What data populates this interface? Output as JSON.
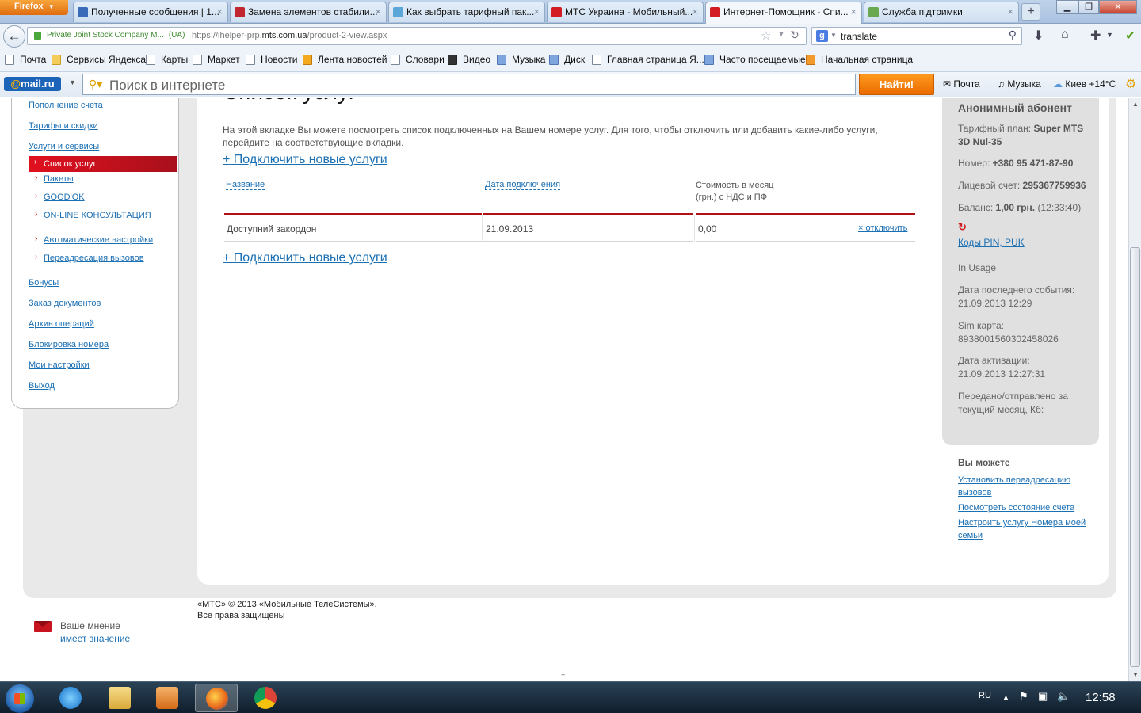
{
  "browser": {
    "app_button": "Firefox",
    "tabs": [
      {
        "title": "Полученные сообщения | 1...",
        "active": false
      },
      {
        "title": "Замена элементов стабили...",
        "active": false
      },
      {
        "title": "Как выбрать тарифный пак...",
        "active": false
      },
      {
        "title": "МТС Украина - Мобильный...",
        "active": false
      },
      {
        "title": "Интернет-Помощник - Спи...",
        "active": true
      },
      {
        "title": "Служба підтримки",
        "active": false
      }
    ],
    "identity": "Private Joint Stock Company M...",
    "identity_country": "(UA)",
    "url_prefix": "https://ihelper-prp.",
    "url_domain": "mts.com.ua",
    "url_path": "/product-2-view.aspx",
    "search_query": "translate",
    "bookmarks": [
      "Почта",
      "Сервисы Яндекса",
      "Карты",
      "Маркет",
      "Новости",
      "Лента новостей",
      "Словари",
      "Видео",
      "Музыка",
      "Диск",
      "Главная страница Я...",
      "Часто посещаемые",
      "Начальная страница"
    ]
  },
  "mailru_bar": {
    "logo_at": "@",
    "logo_text": "mail.ru",
    "search_placeholder": "Поиск в интернете",
    "find_button": "Найти!",
    "mail_label": "Почта",
    "music_label": "Музыка",
    "weather": "Киев +14°C"
  },
  "sidebar": {
    "links": [
      "Пополнение счета",
      "Тарифы и скидки",
      "Услуги и сервисы"
    ],
    "active_sub": "Список услуг",
    "subs": [
      "Пакеты",
      "GOOD'OK",
      "ON-LINE КОНСУЛЬТАЦИЯ",
      "Автоматические настройки",
      "Переадресация вызовов"
    ],
    "links_bottom": [
      "Бонусы",
      "Заказ документов",
      "Архив операций",
      "Блокировка номера",
      "Мои настройки",
      "Выход"
    ]
  },
  "main": {
    "title": "Список услуг",
    "intro": "На этой вкладке Вы можете посмотреть список подключенных на Вашем номере услуг. Для того, чтобы отключить или добавить какие-либо услуги, перейдите на соответствующие вкладки.",
    "add_link": "+ Подключить новые услуги",
    "columns": {
      "name": "Название",
      "date": "Дата подключения",
      "cost_line1": "Стоимость в месяц",
      "cost_line2": "(грн.) с НДС и ПФ"
    },
    "rows": [
      {
        "name": "Доступний закордон",
        "date": "21.09.2013",
        "cost": "0,00",
        "action": "× отключить"
      }
    ]
  },
  "account": {
    "name": "Анонимный абонент",
    "plan_label": "Тарифный план:",
    "plan_value": "Super MTS 3D Nul-35",
    "number_label": "Номер:",
    "number_value": "+380 95 471-87-90",
    "account_label": "Лицевой счет:",
    "account_value": "295367759936",
    "balance_label": "Баланс:",
    "balance_value": "1,00 грн.",
    "balance_time": "(12:33:40)",
    "codes_link": "Коды PIN, PUK",
    "status": "In Usage",
    "last_event_label": "Дата последнего события:",
    "last_event_value": "21.09.2013 12:29",
    "sim_label": "Sim карта:",
    "sim_value": "8938001560302458026",
    "activation_label": "Дата активации:",
    "activation_value": "21.09.2013 12:27:31",
    "traffic_label": "Передано/отправлено за текущий месяц, Кб:"
  },
  "you_can": {
    "title": "Вы можете",
    "links": [
      "Установить переадресацию вызовов",
      "Посмотреть состояние счета",
      "Настроить услугу Номера моей семьи"
    ]
  },
  "footer": {
    "copyright_line1": "«МТС» © 2013 «Мобильные ТелеСистемы».",
    "copyright_line2": "Все права защищены",
    "opinion_line1": "Ваше мнение",
    "opinion_line2": "имеет значение"
  },
  "taskbar": {
    "lang": "RU",
    "clock": "12:58"
  },
  "colors": {
    "mts_red": "#c8141e",
    "link_blue": "#1b6fb3",
    "mailru_orange": "#f28a0f"
  }
}
